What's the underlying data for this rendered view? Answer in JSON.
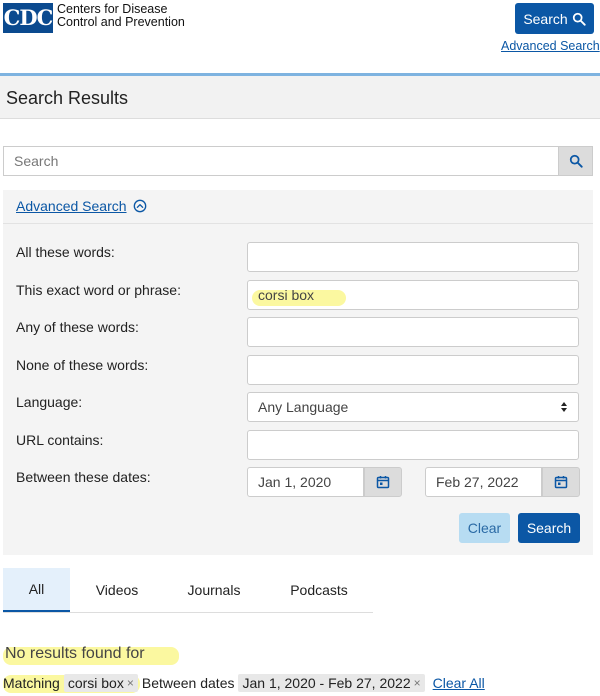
{
  "header": {
    "logo_mark": "CDC",
    "logo_line1": "Centers for Disease",
    "logo_line2": "Control and Prevention",
    "search_button": "Search",
    "advanced_link": "Advanced Search"
  },
  "page_title": "Search Results",
  "search": {
    "placeholder": "Search",
    "value": ""
  },
  "advanced": {
    "toggle_label": "Advanced Search",
    "rows": [
      {
        "label": "All these words:",
        "value": ""
      },
      {
        "label": "This exact word or phrase:",
        "value": "corsi box"
      },
      {
        "label": "Any of these words:",
        "value": ""
      },
      {
        "label": "None of these words:",
        "value": ""
      },
      {
        "label": "Language:",
        "value": "Any Language"
      },
      {
        "label": "URL contains:",
        "value": ""
      },
      {
        "label": "Between these dates:",
        "value": ""
      }
    ],
    "date_from": "Jan 1, 2020",
    "date_to": "Feb 27, 2022",
    "clear_label": "Clear",
    "submit_label": "Search"
  },
  "tabs": [
    {
      "label": "All",
      "active": true
    },
    {
      "label": "Videos",
      "active": false
    },
    {
      "label": "Journals",
      "active": false
    },
    {
      "label": "Podcasts",
      "active": false
    }
  ],
  "results": {
    "no_results_text": "No results found for",
    "matching_label": "Matching",
    "matching_chip": "corsi box",
    "between_label": "Between dates",
    "dates_chip": "Jan 1, 2020 - Feb 27, 2022",
    "chip_remove": "×",
    "clear_all": "Clear All"
  },
  "colors": {
    "brand_blue": "#0b57a5",
    "highlight": "#fbf8a0",
    "light_blue": "#b7dcf2"
  },
  "icons": [
    "search-icon",
    "chevron-up-circle-icon",
    "calendar-icon",
    "select-arrows-icon",
    "close-icon"
  ]
}
